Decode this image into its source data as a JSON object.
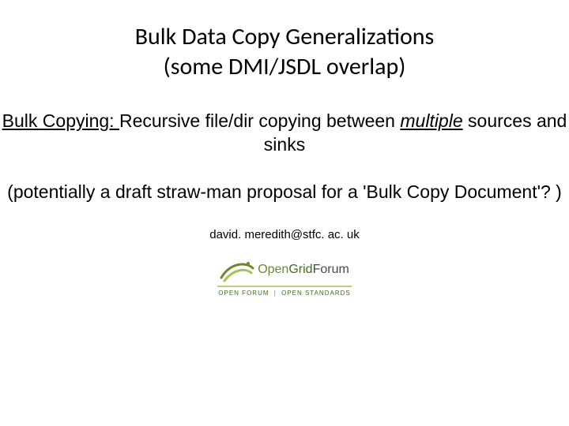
{
  "title": {
    "line1": "Bulk Data Copy Generalizations",
    "line2": "(some DMI/JSDL overlap)"
  },
  "subtitle1": {
    "prefix": "Bulk Copying: ",
    "rest1": "Recursive file/dir copying between ",
    "multiple": "multiple",
    "rest2": " sources and sinks"
  },
  "subtitle2": "(potentially a draft straw-man proposal for a 'Bulk Copy Document'? )",
  "email": "david. meredith@stfc. ac. uk",
  "logo": {
    "word1": "Open",
    "word2": "Grid",
    "word3": "Forum",
    "sub_left": "OPEN FORUM",
    "sub_sep": "|",
    "sub_right": "OPEN STANDARDS"
  }
}
